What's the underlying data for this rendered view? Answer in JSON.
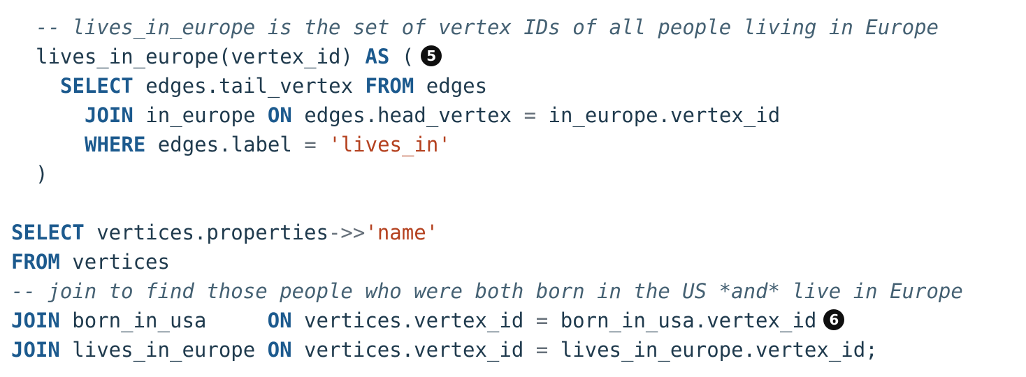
{
  "code": {
    "lines": [
      {
        "indent": 1,
        "tokens": [
          {
            "type": "cm",
            "text": "-- lives_in_europe is the set of vertex IDs of all people living in Europe"
          }
        ]
      },
      {
        "indent": 1,
        "tokens": [
          {
            "type": "id",
            "text": "lives_in_europe(vertex_id) "
          },
          {
            "type": "kw",
            "text": "AS"
          },
          {
            "type": "punct",
            "text": " ("
          }
        ],
        "callout": "5"
      },
      {
        "indent": 2,
        "tokens": [
          {
            "type": "kw",
            "text": "SELECT"
          },
          {
            "type": "id",
            "text": " edges.tail_vertex "
          },
          {
            "type": "kw",
            "text": "FROM"
          },
          {
            "type": "id",
            "text": " edges"
          }
        ]
      },
      {
        "indent": 3,
        "tokens": [
          {
            "type": "kw",
            "text": "JOIN"
          },
          {
            "type": "id",
            "text": " in_europe "
          },
          {
            "type": "kw",
            "text": "ON"
          },
          {
            "type": "id",
            "text": " edges.head_vertex "
          },
          {
            "type": "op",
            "text": "="
          },
          {
            "type": "id",
            "text": " in_europe.vertex_id"
          }
        ]
      },
      {
        "indent": 3,
        "tokens": [
          {
            "type": "kw",
            "text": "WHERE"
          },
          {
            "type": "id",
            "text": " edges.label "
          },
          {
            "type": "op",
            "text": "="
          },
          {
            "type": "id",
            "text": " "
          },
          {
            "type": "str",
            "text": "'lives_in'"
          }
        ]
      },
      {
        "indent": 1,
        "tokens": [
          {
            "type": "punct",
            "text": ")"
          }
        ]
      },
      {
        "indent": 0,
        "tokens": []
      },
      {
        "indent": 0,
        "tokens": [
          {
            "type": "kw",
            "text": "SELECT"
          },
          {
            "type": "id",
            "text": " vertices.properties"
          },
          {
            "type": "op",
            "text": "->>"
          },
          {
            "type": "str",
            "text": "'name'"
          }
        ]
      },
      {
        "indent": 0,
        "tokens": [
          {
            "type": "kw",
            "text": "FROM"
          },
          {
            "type": "id",
            "text": " vertices"
          }
        ]
      },
      {
        "indent": 0,
        "tokens": [
          {
            "type": "cm",
            "text": "-- join to find those people who were both born in the US *and* live in Europe"
          }
        ]
      },
      {
        "indent": 0,
        "tokens": [
          {
            "type": "kw",
            "text": "JOIN"
          },
          {
            "type": "id",
            "text": " born_in_usa     "
          },
          {
            "type": "kw",
            "text": "ON"
          },
          {
            "type": "id",
            "text": " vertices.vertex_id "
          },
          {
            "type": "op",
            "text": "="
          },
          {
            "type": "id",
            "text": " born_in_usa.vertex_id"
          }
        ],
        "callout": "6"
      },
      {
        "indent": 0,
        "tokens": [
          {
            "type": "kw",
            "text": "JOIN"
          },
          {
            "type": "id",
            "text": " lives_in_europe "
          },
          {
            "type": "kw",
            "text": "ON"
          },
          {
            "type": "id",
            "text": " vertices.vertex_id "
          },
          {
            "type": "op",
            "text": "="
          },
          {
            "type": "id",
            "text": " lives_in_europe.vertex_id;"
          }
        ]
      }
    ]
  }
}
